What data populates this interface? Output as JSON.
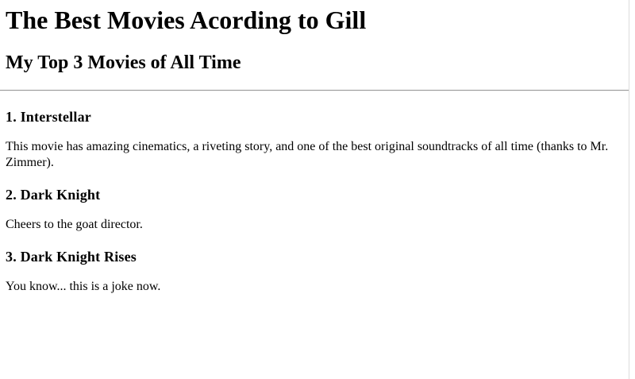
{
  "page": {
    "title": "The Best Movies Acording to Gill",
    "subtitle": "My Top 3 Movies of All Time"
  },
  "movies": [
    {
      "title": "1. Interstellar",
      "description": "This movie has amazing cinematics, a riveting story, and one of the best original soundtracks of all time (thanks to Mr. Zimmer)."
    },
    {
      "title": "2. Dark Knight",
      "description": "Cheers to the goat director."
    },
    {
      "title": "3. Dark Knight Rises",
      "description": "You know... this is a joke now."
    }
  ]
}
